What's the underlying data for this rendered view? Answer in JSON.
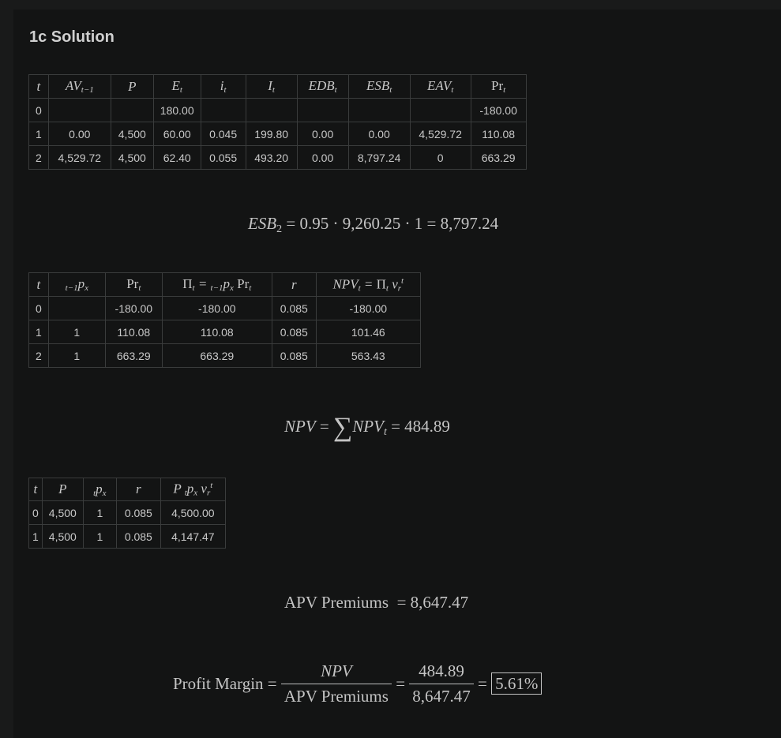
{
  "title": "1c Solution",
  "table1": {
    "headers": [
      "t",
      "AV",
      "P",
      "E",
      "i",
      "I",
      "EDB",
      "ESB",
      "EAV",
      "Pr"
    ],
    "rows": [
      [
        "0",
        "",
        "",
        "180.00",
        "",
        "",
        "",
        "",
        "",
        "-180.00"
      ],
      [
        "1",
        "0.00",
        "4,500",
        "60.00",
        "0.045",
        "199.80",
        "0.00",
        "0.00",
        "4,529.72",
        "110.08"
      ],
      [
        "2",
        "4,529.72",
        "4,500",
        "62.40",
        "0.055",
        "493.20",
        "0.00",
        "8,797.24",
        "0",
        "663.29"
      ]
    ]
  },
  "eq_esb": {
    "lhs": "ESB",
    "sub": "2",
    "rhs": "= 0.95 · 9,260.25 · 1 = 8,797.24"
  },
  "table2": {
    "headers": [
      "t",
      "p",
      "Pr",
      "Π = p Pr",
      "r",
      "NPV = Π v"
    ],
    "rows": [
      [
        "0",
        "",
        "-180.00",
        "-180.00",
        "0.085",
        "-180.00"
      ],
      [
        "1",
        "1",
        "110.08",
        "110.08",
        "0.085",
        "101.46"
      ],
      [
        "2",
        "1",
        "663.29",
        "663.29",
        "0.085",
        "563.43"
      ]
    ]
  },
  "eq_npv": {
    "lhs": "NPV",
    "mid": "NPV",
    "result": "= 484.89"
  },
  "table3": {
    "headers": [
      "t",
      "P",
      "p",
      "r",
      "P p v"
    ],
    "rows": [
      [
        "0",
        "4,500",
        "1",
        "0.085",
        "4,500.00"
      ],
      [
        "1",
        "4,500",
        "1",
        "0.085",
        "4,147.47"
      ]
    ]
  },
  "eq_apv": {
    "label": "APV Premiums",
    "result": "= 8,647.47"
  },
  "eq_margin": {
    "label": "Profit Margin",
    "num1": "NPV",
    "den1": "APV Premiums",
    "num2": "484.89",
    "den2": "8,647.47",
    "result": "5.61%"
  }
}
